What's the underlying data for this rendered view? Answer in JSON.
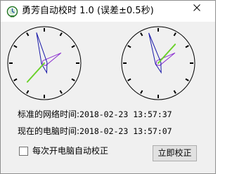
{
  "window": {
    "title": "勇芳自动校时 1.0 (误差±0.5秒)",
    "icon": "app-clock-icon",
    "close_icon": "close-icon"
  },
  "clocks": {
    "network": {
      "hour": 13,
      "minute": 57,
      "second": 37
    },
    "computer": {
      "hour": 13,
      "minute": 57,
      "second": 7
    },
    "colors": {
      "hour_hand": "#8b2fd0",
      "minute_hand": "#1a1aa8",
      "second_hand": "#6ad12a",
      "ticks": "#000000"
    }
  },
  "time_lines": {
    "network_label": "标准的网络时间:",
    "network_value": "2018-02-23 13:57:37",
    "computer_label": "现在的电脑时间:",
    "computer_value": "2018-02-23 13:57:07"
  },
  "controls": {
    "auto_sync_label": "每次开电脑自动校正",
    "auto_sync_checked": false,
    "sync_button_label": "立即校正"
  }
}
